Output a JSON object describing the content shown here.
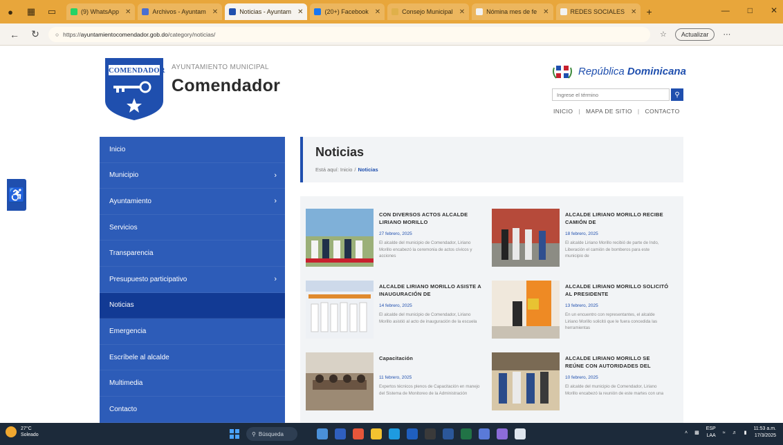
{
  "browser": {
    "tabs": [
      {
        "label": "(9) WhatsApp",
        "color": "#25d366",
        "active": false
      },
      {
        "label": "Archivos - Ayuntam",
        "color": "#4a6fd1",
        "active": false
      },
      {
        "label": "Noticias - Ayuntam",
        "color": "#1f4fae",
        "active": true
      },
      {
        "label": "(20+) Facebook",
        "color": "#1877f2",
        "active": false
      },
      {
        "label": "Consejo Municipal",
        "color": "#e0b04a",
        "active": false
      },
      {
        "label": "Nómina mes de fe",
        "color": "#f2f2f2",
        "active": false
      },
      {
        "label": "REDES SOCIALES",
        "color": "#f2f2f2",
        "active": false
      }
    ],
    "new_tab": "+",
    "url_scheme": "https://",
    "url_domain": "ayuntamientocomendador.gob.do",
    "url_path": "/category/noticias/",
    "update_label": "Actualizar"
  },
  "header": {
    "logo_word": "COMENDADOR",
    "kicker": "AYUNTAMIENTO MUNICIPAL",
    "org_name": "Comendador",
    "rd_brand_prefix": "República ",
    "rd_brand_bold": "Dominicana",
    "search_placeholder": "Ingrese el término",
    "util_links": [
      "INICIO",
      "MAPA DE SITIO",
      "CONTACTO"
    ]
  },
  "sidebar": {
    "items": [
      {
        "label": "Inicio",
        "has_chevron": false
      },
      {
        "label": "Municipio",
        "has_chevron": true
      },
      {
        "label": "Ayuntamiento",
        "has_chevron": true
      },
      {
        "label": "Servicios",
        "has_chevron": false
      },
      {
        "label": "Transparencia",
        "has_chevron": false
      },
      {
        "label": "Presupuesto participativo",
        "has_chevron": true
      },
      {
        "label": "Noticias",
        "has_chevron": false,
        "active": true
      },
      {
        "label": "Emergencia",
        "has_chevron": false
      },
      {
        "label": "Escríbele al alcalde",
        "has_chevron": false
      },
      {
        "label": "Multimedia",
        "has_chevron": false
      },
      {
        "label": "Contacto",
        "has_chevron": false
      }
    ]
  },
  "main": {
    "title": "Noticias",
    "breadcrumb_prefix": "Está aquí:",
    "breadcrumb_home": "Inicio",
    "breadcrumb_current": "Noticias",
    "news": [
      {
        "title": "CON DIVERSOS ACTOS ALCALDE LIRIANO MORILLO",
        "date": "27 febrero, 2025",
        "excerpt": "El alcalde del municipio de Comendador, Liriano Morillo encabezó la ceremonia de actos cívicos y acciones"
      },
      {
        "title": "ALCALDE LIRIANO MORILLO RECIBE CAMIÓN DE",
        "date": "18 febrero, 2025",
        "excerpt": "El alcalde Liriano Morillo recibió de parte de Indo, Liberación el camión de bomberos para este municipio de"
      },
      {
        "title": "ALCALDE LIRIANO MORILLO ASISTE A INAUGURACIÓN DE",
        "date": "14 febrero, 2025",
        "excerpt": "El alcalde del municipio de Comendador, Liriano Morillo asistió al acto de inauguración de la escuela"
      },
      {
        "title": "ALCALDE LIRIANO MORILLO SOLICITÓ AL PRESIDENTE",
        "date": "13 febrero, 2025",
        "excerpt": "En un encuentro con representantes, el alcalde Liriano Morillo solicitó que le fuera concedida las herramientas"
      },
      {
        "title": "Capacitación",
        "date": "11 febrero, 2025",
        "excerpt": "Expertos técnicos plenos de Capacitación en manejo del Sistema de Monitoreo de la Administración"
      },
      {
        "title": "ALCALDE LIRIANO MORILLO SE REÚNE CON AUTORIDADES DEL",
        "date": "10 febrero, 2025",
        "excerpt": "El alcalde del municipio de Comendador, Liriano Morillo encabezó la reunión de este martes con una"
      }
    ]
  },
  "taskbar": {
    "temp": "27°C",
    "weather_text": "Soleado",
    "search_label": "Búsqueda",
    "lang": "ESP",
    "lang_sub": "LAA",
    "time": "11:53 a.m.",
    "date": "17/3/2025"
  },
  "colors": {
    "brand_blue": "#2d5cb8",
    "active_blue": "#123a94",
    "browser_frame": "#e8a63b"
  }
}
